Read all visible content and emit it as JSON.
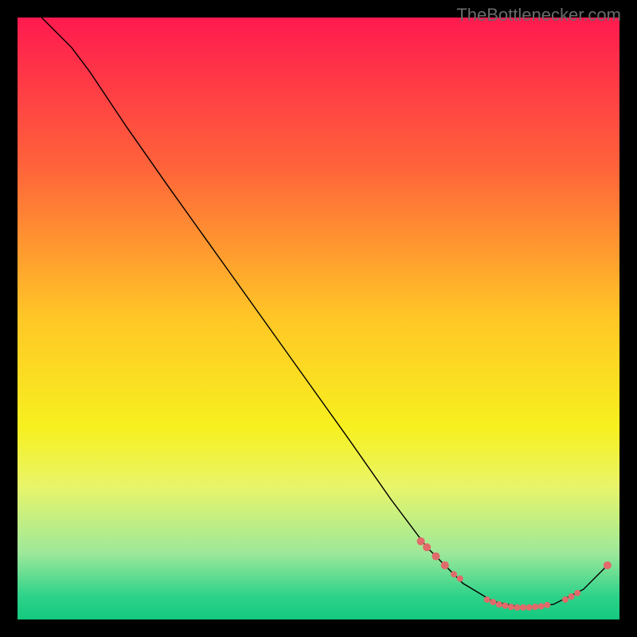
{
  "watermark": "TheBottlenecker.com",
  "chart_data": {
    "type": "line",
    "title": "",
    "xlabel": "",
    "ylabel": "",
    "xlim": [
      0,
      100
    ],
    "ylim": [
      0,
      100
    ],
    "gradient_stops": [
      {
        "offset": 0,
        "color": "#ff1a4f"
      },
      {
        "offset": 25,
        "color": "#ff643a"
      },
      {
        "offset": 50,
        "color": "#ffc726"
      },
      {
        "offset": 68,
        "color": "#f7f01f"
      },
      {
        "offset": 78,
        "color": "#e8f56a"
      },
      {
        "offset": 89,
        "color": "#9de89a"
      },
      {
        "offset": 96,
        "color": "#2fd38a"
      },
      {
        "offset": 100,
        "color": "#13c97e"
      }
    ],
    "series": [
      {
        "name": "curve",
        "type": "line",
        "points": [
          {
            "x": 4,
            "y": 100
          },
          {
            "x": 6,
            "y": 98
          },
          {
            "x": 9,
            "y": 95
          },
          {
            "x": 12,
            "y": 91
          },
          {
            "x": 18,
            "y": 82
          },
          {
            "x": 25,
            "y": 72
          },
          {
            "x": 35,
            "y": 58
          },
          {
            "x": 45,
            "y": 44
          },
          {
            "x": 55,
            "y": 30
          },
          {
            "x": 62,
            "y": 20
          },
          {
            "x": 68,
            "y": 12
          },
          {
            "x": 74,
            "y": 6
          },
          {
            "x": 79,
            "y": 3
          },
          {
            "x": 84,
            "y": 2
          },
          {
            "x": 89,
            "y": 2.5
          },
          {
            "x": 94,
            "y": 5
          },
          {
            "x": 98,
            "y": 9
          }
        ]
      },
      {
        "name": "markers",
        "type": "scatter",
        "color": "#e16a6a",
        "points": [
          {
            "x": 67,
            "y": 13,
            "r": 5
          },
          {
            "x": 68,
            "y": 12,
            "r": 5
          },
          {
            "x": 69.5,
            "y": 10.5,
            "r": 5
          },
          {
            "x": 71,
            "y": 9,
            "r": 5
          },
          {
            "x": 72.5,
            "y": 7.5,
            "r": 4
          },
          {
            "x": 73.5,
            "y": 6.8,
            "r": 4
          },
          {
            "x": 78,
            "y": 3.3,
            "r": 4
          },
          {
            "x": 79,
            "y": 2.9,
            "r": 4
          },
          {
            "x": 80,
            "y": 2.5,
            "r": 4
          },
          {
            "x": 81,
            "y": 2.3,
            "r": 4
          },
          {
            "x": 82,
            "y": 2.1,
            "r": 4
          },
          {
            "x": 83,
            "y": 2.0,
            "r": 4
          },
          {
            "x": 84,
            "y": 2.0,
            "r": 4
          },
          {
            "x": 85,
            "y": 2.0,
            "r": 4
          },
          {
            "x": 86,
            "y": 2.1,
            "r": 4
          },
          {
            "x": 87,
            "y": 2.2,
            "r": 4
          },
          {
            "x": 88,
            "y": 2.4,
            "r": 4
          },
          {
            "x": 91,
            "y": 3.3,
            "r": 4
          },
          {
            "x": 92,
            "y": 3.8,
            "r": 4
          },
          {
            "x": 93,
            "y": 4.4,
            "r": 4
          },
          {
            "x": 98,
            "y": 9,
            "r": 5
          }
        ]
      }
    ]
  }
}
